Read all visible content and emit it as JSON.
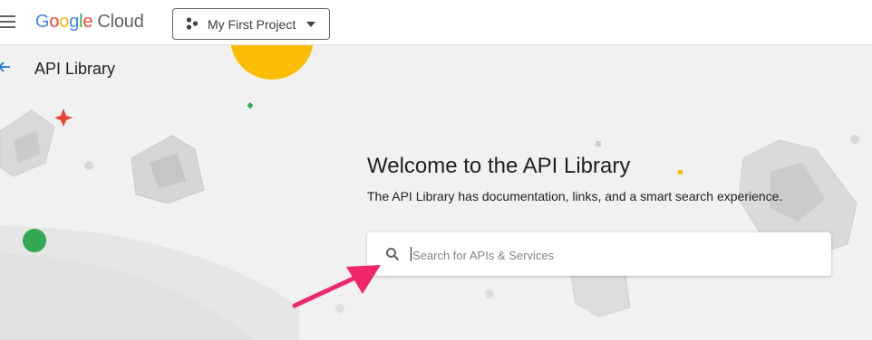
{
  "header": {
    "logo": {
      "brand": "Google",
      "product": "Cloud"
    },
    "project_selector": {
      "label": "My First Project",
      "icon": "project-dots-icon"
    }
  },
  "page": {
    "title": "API Library",
    "back_icon": "arrow-back-icon"
  },
  "hero": {
    "heading": "Welcome to the API Library",
    "description": "The API Library has documentation, links, and a smart search experience."
  },
  "search": {
    "placeholder": "Search for APIs & Services",
    "value": "",
    "icon": "search-icon"
  },
  "annotation": {
    "icon": "pointer-arrow-icon",
    "color": "#f0266a"
  },
  "colors": {
    "blue": "#4285f4",
    "red": "#ea4335",
    "yellow": "#fbbc04",
    "green": "#34a853",
    "background": "#f1f1f1"
  }
}
